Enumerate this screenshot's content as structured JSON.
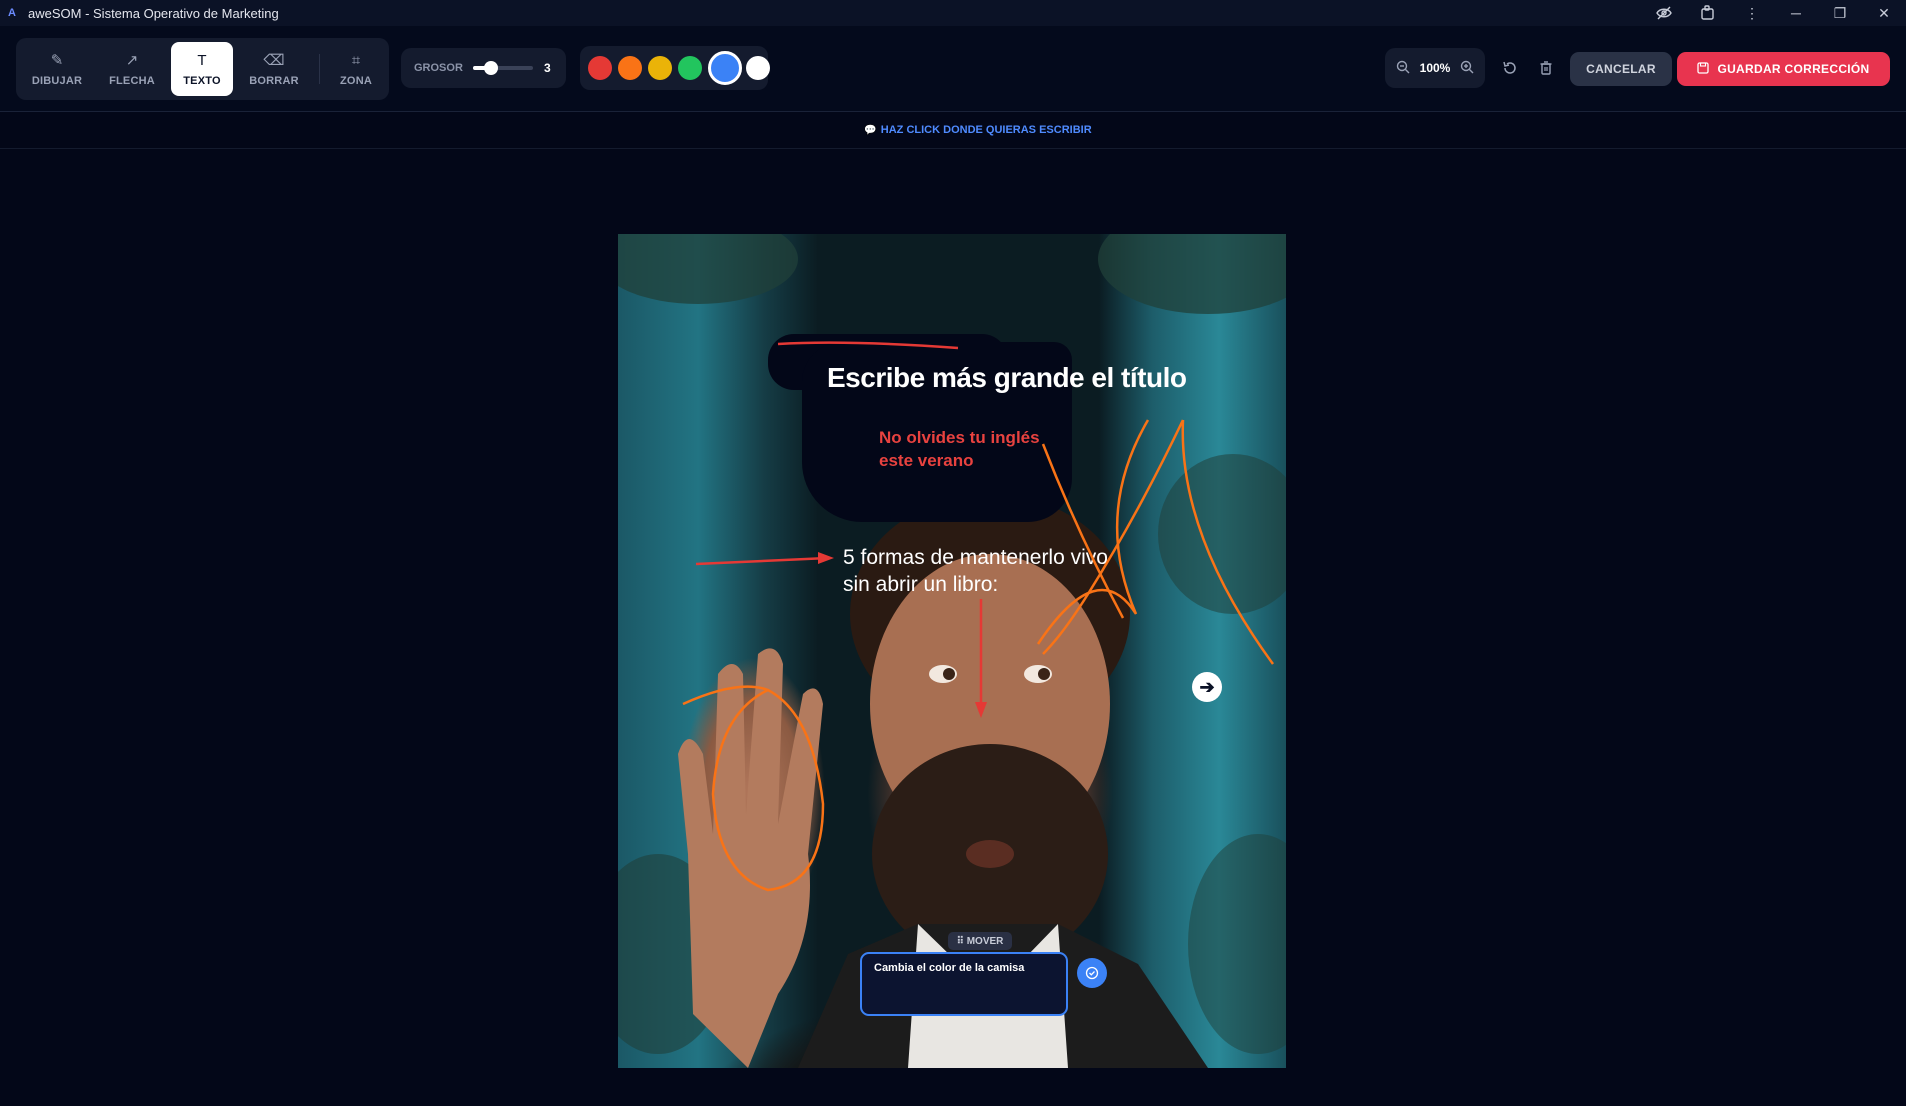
{
  "window": {
    "title": "aweSOM - Sistema Operativo de Marketing",
    "logo": "A"
  },
  "toolbar": {
    "tools": [
      {
        "label": "DIBUJAR",
        "icon": "pencil-icon",
        "glyph": "✎",
        "active": false
      },
      {
        "label": "FLECHA",
        "icon": "arrow-up-right-icon",
        "glyph": "↗",
        "active": false
      },
      {
        "label": "TEXTO",
        "icon": "text-icon",
        "glyph": "T",
        "active": true
      },
      {
        "label": "BORRAR",
        "icon": "eraser-icon",
        "glyph": "⌫",
        "active": false
      },
      {
        "label": "ZONA",
        "icon": "crop-icon",
        "glyph": "⌗",
        "active": false
      }
    ],
    "grosor": {
      "label": "GROSOR",
      "value": "3",
      "level": 0.3
    },
    "colors": [
      {
        "name": "red",
        "hex": "#e53935",
        "selected": false
      },
      {
        "name": "orange",
        "hex": "#f97316",
        "selected": false
      },
      {
        "name": "yellow",
        "hex": "#eab308",
        "selected": false
      },
      {
        "name": "green",
        "hex": "#22c55e",
        "selected": false
      },
      {
        "name": "blue",
        "hex": "#3b82f6",
        "selected": true
      },
      {
        "name": "white",
        "hex": "#ffffff",
        "selected": false
      }
    ],
    "zoom": {
      "value": "100%",
      "out_icon": "zoom-out-icon",
      "in_icon": "zoom-in-icon"
    },
    "cancel_label": "CANCELAR",
    "save_label": "GUARDAR CORRECCIÓN"
  },
  "hint": {
    "text": "HAZ CLICK DONDE QUIERAS ESCRIBIR"
  },
  "image": {
    "title": "Escribe más grande el título",
    "red_text": "No olvides tu inglés este verano",
    "subtitle": "5 formas de mantenerlo vivo sin abrir un libro:",
    "next_arrow": "➔"
  },
  "annotation": {
    "mover_label": "⠿ MOVER",
    "text_value": "Cambia el color de la camisa"
  },
  "colors": {
    "accent": "#3b82f6",
    "danger": "#e8344f",
    "background": "#030718"
  }
}
